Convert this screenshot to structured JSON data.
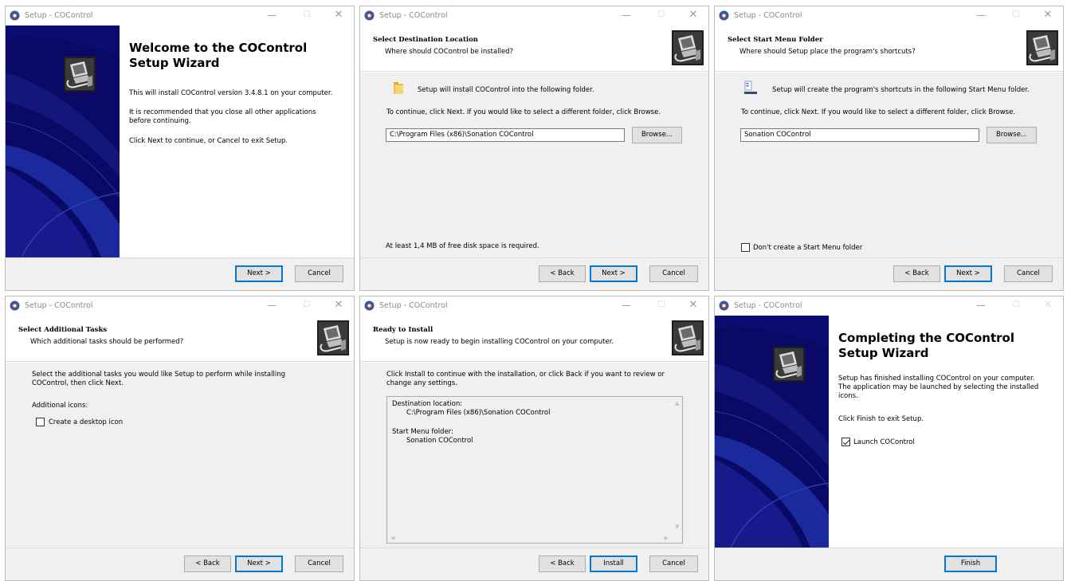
{
  "window_title": "Setup - COControl",
  "titlebar": {
    "minimize": "—",
    "maximize": "☐",
    "close": "✕"
  },
  "buttons": {
    "back": "< Back",
    "next": "Next >",
    "cancel": "Cancel",
    "browse": "Browse...",
    "install": "Install",
    "finish": "Finish"
  },
  "welcome": {
    "title_line1": "Welcome to the COControl",
    "title_line2": "Setup Wizard",
    "p1": "This will install COControl version 3.4.8.1 on your computer.",
    "p2_line1": "It is recommended that you close all other applications",
    "p2_line2": "before continuing.",
    "p3": "Click Next to continue, or Cancel to exit Setup."
  },
  "destination": {
    "title": "Select Destination Location",
    "subtitle": "Where should COControl be installed?",
    "info": "Setup will install COControl into the following folder.",
    "instruction": "To continue, click Next. If you would like to select a different folder, click Browse.",
    "path": "C:\\Program Files (x86)\\Sonation COControl",
    "disk_space": "At least 1,4 MB of free disk space is required."
  },
  "start_menu": {
    "title": "Select Start Menu Folder",
    "subtitle": "Where should Setup place the program's shortcuts?",
    "info": "Setup will create the program's shortcuts in the following Start Menu folder.",
    "instruction": "To continue, click Next. If you would like to select a different folder, click Browse.",
    "folder": "Sonation COControl",
    "no_folder_label": "Don't create a Start Menu folder"
  },
  "tasks": {
    "title": "Select Additional Tasks",
    "subtitle": "Which additional tasks should be performed?",
    "instruction_line1": "Select the additional tasks you would like Setup to perform while installing",
    "instruction_line2": "COControl, then click Next.",
    "group_label": "Additional icons:",
    "desktop_icon_label": "Create a desktop icon"
  },
  "ready": {
    "title": "Ready to Install",
    "subtitle": "Setup is now ready to begin installing COControl on your computer.",
    "instruction_line1": "Click Install to continue with the installation, or click Back if you want to review or",
    "instruction_line2": "change any settings.",
    "dest_label": "Destination location:",
    "dest_value": "C:\\Program Files (x86)\\Sonation COControl",
    "menu_label": "Start Menu folder:",
    "menu_value": "Sonation COControl"
  },
  "finished": {
    "title_line1": "Completing the COControl",
    "title_line2": "Setup Wizard",
    "p1_line1": "Setup has finished installing COControl on your computer.",
    "p1_line2": "The application may be launched by selecting the installed",
    "p1_line3": "icons.",
    "p2": "Click Finish to exit Setup.",
    "launch_label": "Launch COControl"
  },
  "colors": {
    "sidebar_dark": "#0a0a66",
    "sidebar_mid": "#1a2a9c",
    "accent": "#0078d7",
    "panel_bg": "#f0f0f0"
  }
}
